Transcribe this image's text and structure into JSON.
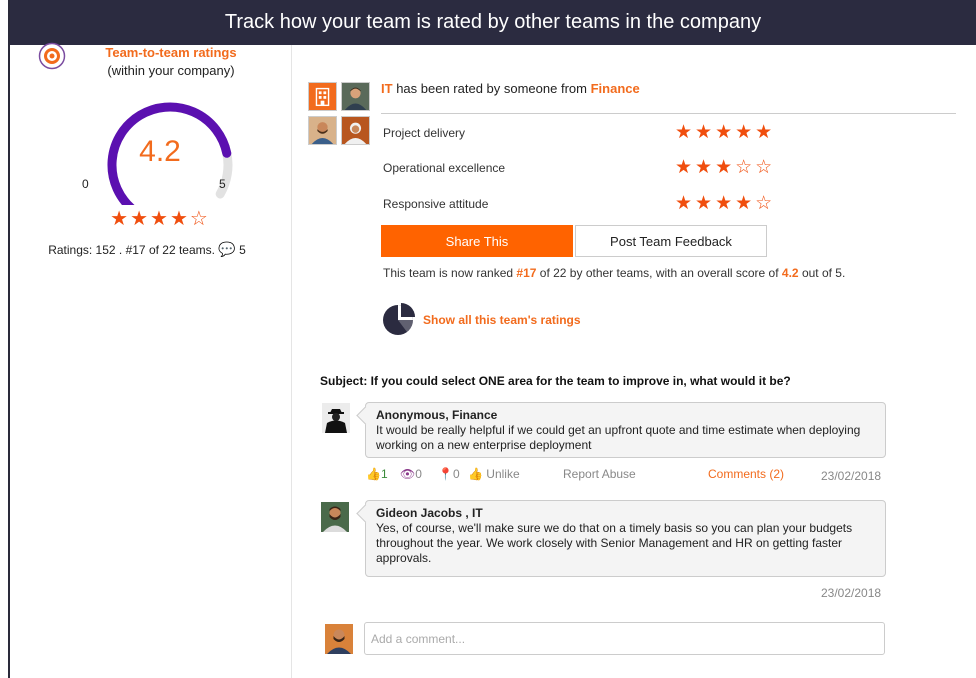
{
  "header": {
    "title": "Track how your team is rated by other teams in the company"
  },
  "summary": {
    "title": "Team-to-team ratings",
    "subtitle": "(within your company)",
    "score": "4.2",
    "gauge_min": "0",
    "gauge_max": "5",
    "score_value": 4.2,
    "score_max": 5,
    "stars": "★★★★☆",
    "ratings_text": "Ratings: 152 . #17 of 22 teams.",
    "comment_count": "5"
  },
  "rating": {
    "team": "IT",
    "rated_by_text": "has been rated by someone from",
    "rater_team": "Finance",
    "criteria": [
      {
        "label": "Project delivery",
        "stars": "★★★★★",
        "value": 5
      },
      {
        "label": "Operational excellence",
        "stars": "★★★☆☆",
        "value": 3
      },
      {
        "label": "Responsive attitude",
        "stars": "★★★★☆",
        "value": 4
      }
    ],
    "share_label": "Share This",
    "post_feedback_label": "Post Team Feedback",
    "rank_prefix": "This team is now ranked",
    "rank": "#17",
    "rank_middle": "of 22 by other teams, with an overall score of",
    "overall_score": "4.2",
    "rank_suffix": "out of 5.",
    "show_all_label": "Show all this team's ratings"
  },
  "discussion": {
    "subject": "Subject: If you could select ONE area for the team to improve in, what would it be?",
    "comments": [
      {
        "author": "Anonymous, Finance",
        "text": "It would be really helpful if we could get an upfront quote and time estimate when deploying working on a new enterprise deployment",
        "likes": "1",
        "views": "0",
        "pins": "0",
        "unlike_label": "Unlike",
        "report_label": "Report Abuse",
        "comments_label": "Comments (2)",
        "date": "23/02/2018"
      },
      {
        "author": "Gideon Jacobs , IT",
        "text": "Yes, of course, we'll make sure we do that on a timely basis so you can plan your budgets throughout the year. We work closely with Senior Management and HR on getting faster approvals.",
        "date": "23/02/2018"
      }
    ],
    "add_comment_placeholder": "Add a comment..."
  },
  "colors": {
    "accent": "#f26b1d",
    "button": "#ff6300",
    "header": "#2b2b40",
    "gauge": "#5b10b0",
    "star": "#f04e0e"
  }
}
